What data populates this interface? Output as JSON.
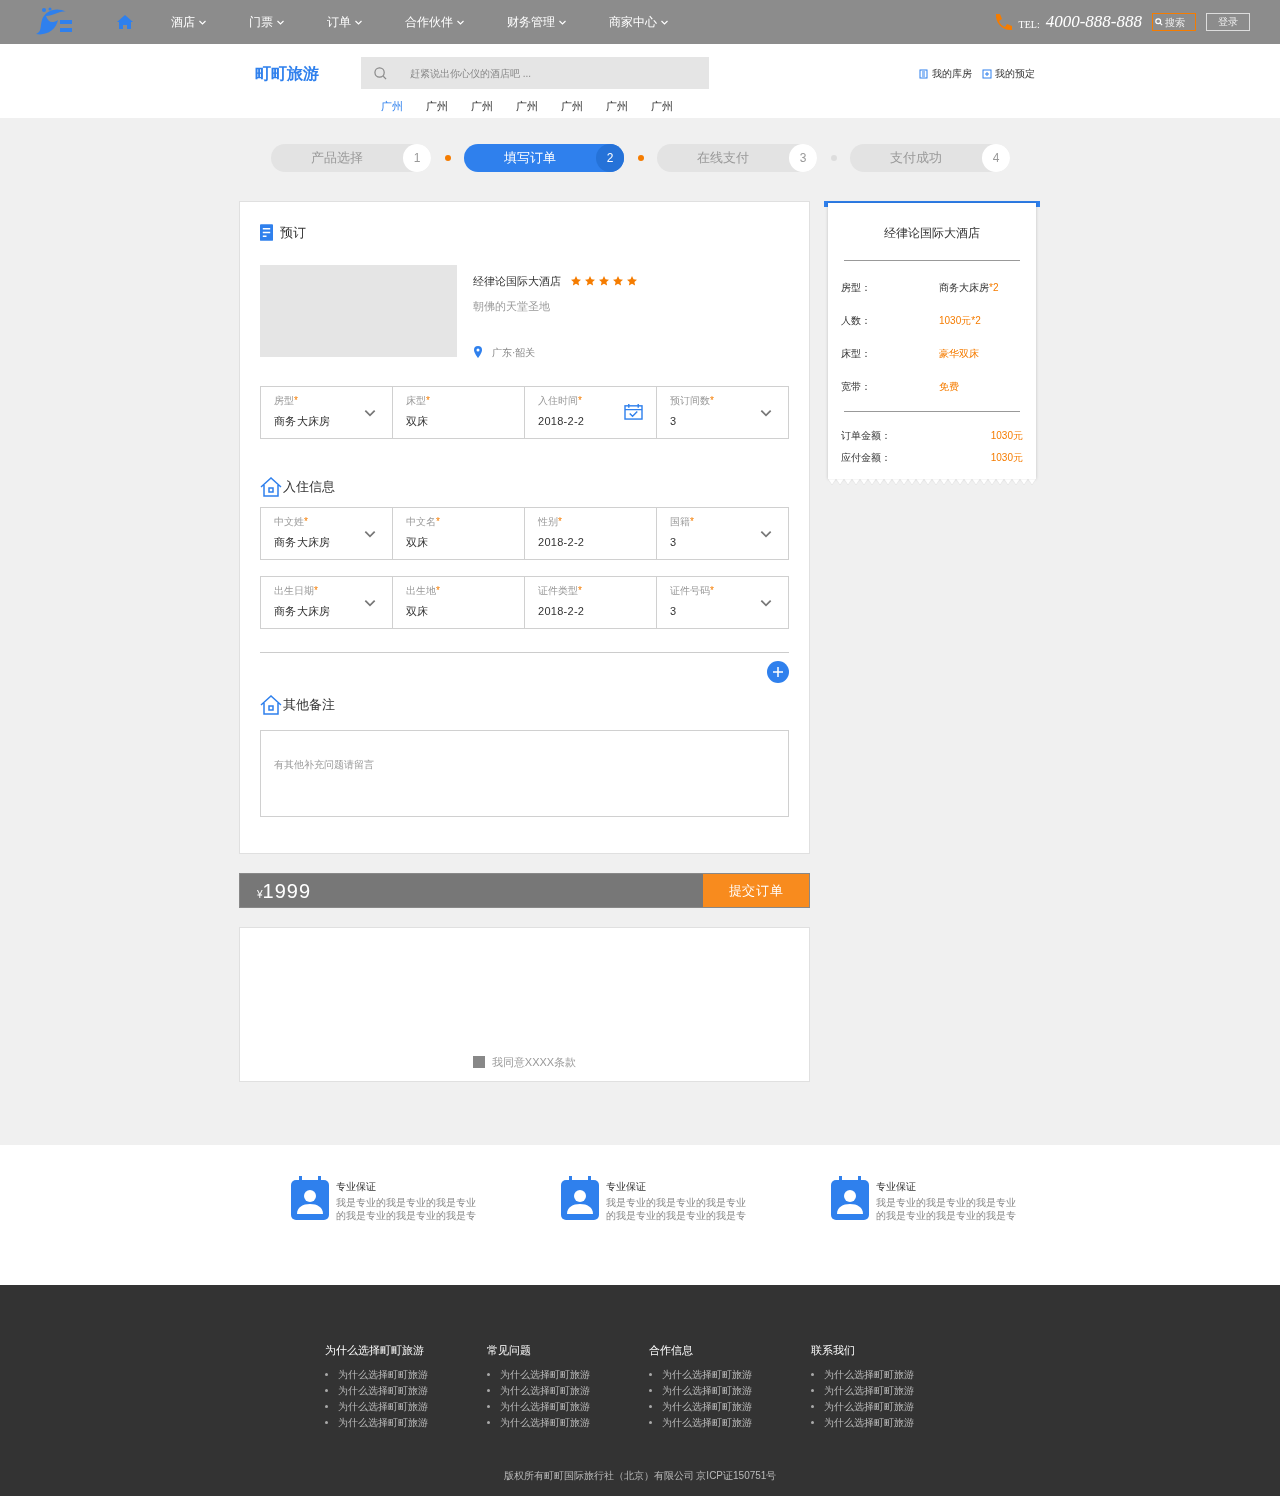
{
  "nav": {
    "items": [
      {
        "label": "酒店",
        "kind": "menu"
      },
      {
        "label": "门票",
        "kind": "menu"
      },
      {
        "label": "订单",
        "kind": "menu"
      },
      {
        "label": "合作伙伴",
        "kind": "menu"
      },
      {
        "label": "财务管理",
        "kind": "menu"
      },
      {
        "label": "商家中心",
        "kind": "menu"
      }
    ],
    "tel_label": "TEL:",
    "tel": "4000-888-888",
    "search": "搜索",
    "login": "登录"
  },
  "header": {
    "brand": "町町旅游",
    "search_placeholder": "赶紧说出你心仪的酒店吧 ...",
    "cities": [
      {
        "label": "广州",
        "selected": true
      },
      {
        "label": "广州",
        "selected": false
      },
      {
        "label": "广州",
        "selected": false
      },
      {
        "label": "广州",
        "selected": false
      },
      {
        "label": "广州",
        "selected": false
      },
      {
        "label": "广州",
        "selected": false
      },
      {
        "label": "广州",
        "selected": false
      }
    ],
    "links": [
      "我的库房",
      "我的预定"
    ]
  },
  "steps": [
    {
      "label": "产品选择",
      "number": "1",
      "selected": false
    },
    {
      "label": "填写订单",
      "number": "2",
      "selected": true
    },
    {
      "label": "在线支付",
      "number": "3",
      "selected": false
    },
    {
      "label": "支付成功",
      "number": "4",
      "selected": false
    }
  ],
  "step_dots": [
    {
      "active": true
    },
    {
      "active": true
    },
    {
      "active": false
    }
  ],
  "booking": {
    "title": "预订",
    "hotel": {
      "name": "经律论国际大酒店",
      "stars": 5,
      "subtitle": "朝佛的天堂圣地",
      "location": "广东·韶关"
    },
    "fields": [
      {
        "label": "房型",
        "mark": "*",
        "value": "商务大床房",
        "kind": "select"
      },
      {
        "label": "床型",
        "mark": "*",
        "value": "双床",
        "kind": "text"
      },
      {
        "label": "入住时间",
        "mark": "*",
        "value": "2018-2-2",
        "kind": "date"
      },
      {
        "label": "预订间数",
        "mark": "*",
        "value": "3",
        "kind": "select"
      }
    ]
  },
  "guest": {
    "title": "入住信息",
    "rows": [
      [
        {
          "label": "中文姓",
          "mark": "*",
          "value": "商务大床房",
          "kind": "select"
        },
        {
          "label": "中文名",
          "mark": "*",
          "value": "双床",
          "kind": "text"
        },
        {
          "label": "性别",
          "mark": "*",
          "value": "2018-2-2",
          "kind": "text"
        },
        {
          "label": "国籍",
          "mark": "*",
          "value": "3",
          "kind": "select"
        }
      ],
      [
        {
          "label": "出生日期",
          "mark": "*",
          "value": "商务大床房",
          "kind": "select"
        },
        {
          "label": "出生地",
          "mark": "*",
          "value": "双床",
          "kind": "text"
        },
        {
          "label": "证件类型",
          "mark": "*",
          "value": "2018-2-2",
          "kind": "text"
        },
        {
          "label": "证件号码",
          "mark": "*",
          "value": "3",
          "kind": "select"
        }
      ]
    ]
  },
  "notes": {
    "title": "其他备注",
    "placeholder": "有其他补充问题请留言"
  },
  "total": {
    "currency": "¥",
    "amount": "1999",
    "submit": "提交订单"
  },
  "terms": {
    "label": "我同意XXXX条款",
    "checked": false
  },
  "summary": {
    "hotel": "经律论国际大酒店",
    "rows": [
      {
        "label": "房型：",
        "value": "商务大床房",
        "suffix": "*2"
      },
      {
        "label": "人数：",
        "value": "1030元*2"
      },
      {
        "label": "床型：",
        "value": "豪华双床"
      },
      {
        "label": "宽带：",
        "value": "免费"
      }
    ],
    "totals": [
      {
        "label": "订单金额：",
        "value": "1030元"
      },
      {
        "label": "应付金额：",
        "value": "1030元"
      }
    ]
  },
  "features": [
    {
      "title": "专业保证",
      "text": "我是专业的我是专业的我是专业的我是专业的我是专业的我是专"
    },
    {
      "title": "专业保证",
      "text": "我是专业的我是专业的我是专业的我是专业的我是专业的我是专"
    },
    {
      "title": "专业保证",
      "text": "我是专业的我是专业的我是专业的我是专业的我是专业的我是专"
    }
  ],
  "footer": {
    "columns": [
      {
        "title": "为什么选择町町旅游",
        "items": [
          "为什么选择町町旅游",
          "为什么选择町町旅游",
          "为什么选择町町旅游",
          "为什么选择町町旅游"
        ]
      },
      {
        "title": "常见问题",
        "items": [
          "为什么选择町町旅游",
          "为什么选择町町旅游",
          "为什么选择町町旅游",
          "为什么选择町町旅游"
        ]
      },
      {
        "title": "合作信息",
        "items": [
          "为什么选择町町旅游",
          "为什么选择町町旅游",
          "为什么选择町町旅游",
          "为什么选择町町旅游"
        ]
      },
      {
        "title": "联系我们",
        "items": [
          "为什么选择町町旅游",
          "为什么选择町町旅游",
          "为什么选择町町旅游",
          "为什么选择町町旅游"
        ]
      }
    ],
    "copyright": "版权所有町町国际旅行社（北京）有限公司 京ICP证150751号"
  }
}
